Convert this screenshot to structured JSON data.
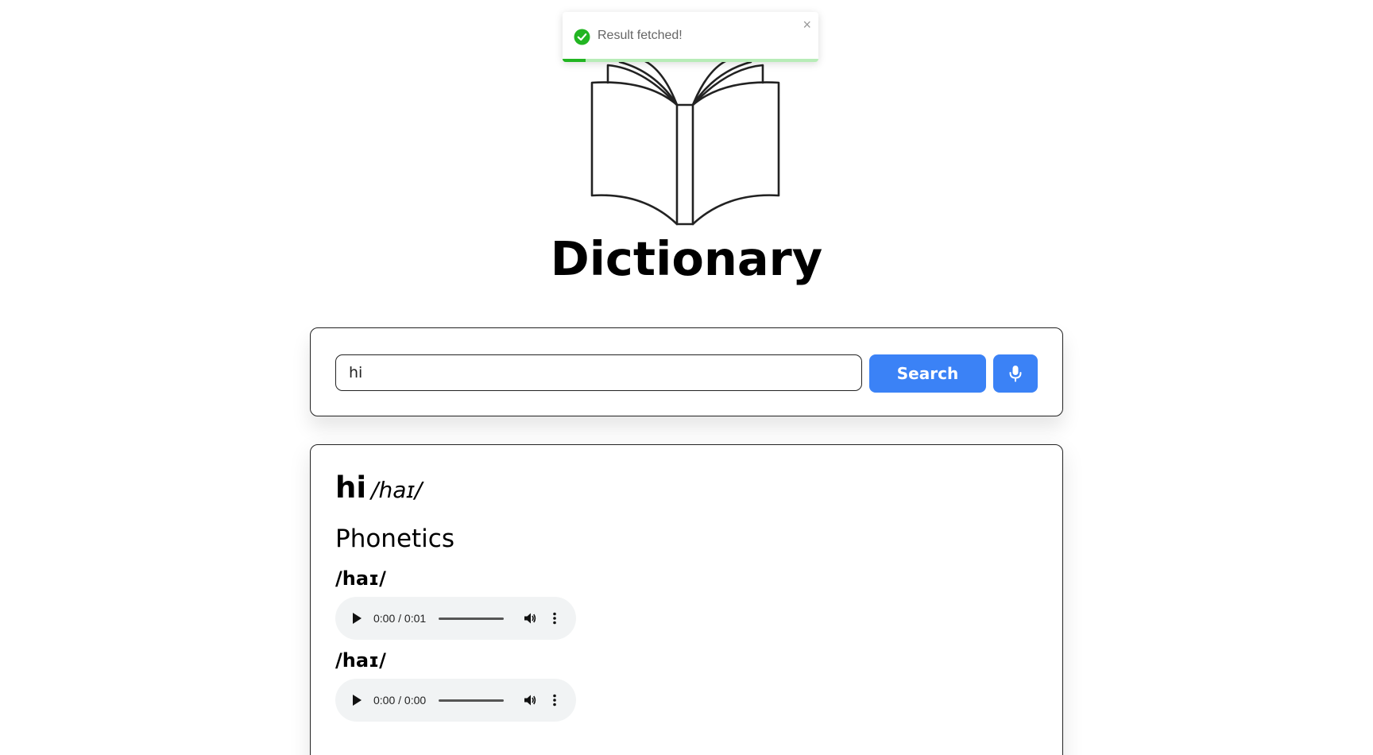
{
  "app": {
    "title": "Dictionary"
  },
  "toast": {
    "message": "Result fetched!",
    "close_label": "×",
    "status": "success",
    "remaining_progress": 0.09,
    "icon": "check-circle-icon",
    "color": "#22b522"
  },
  "search": {
    "value": "hi",
    "placeholder": "",
    "button_label": "Search",
    "mic_icon": "microphone-icon",
    "accent_color": "#3b82f6"
  },
  "result": {
    "word": "hi",
    "phonetic": "/haɪ/",
    "phonetics_heading": "Phonetics",
    "phonetics": [
      {
        "text": "/haɪ/",
        "time": "0:00 / 0:01"
      },
      {
        "text": "/haɪ/",
        "time": "0:00 / 0:00"
      }
    ]
  }
}
